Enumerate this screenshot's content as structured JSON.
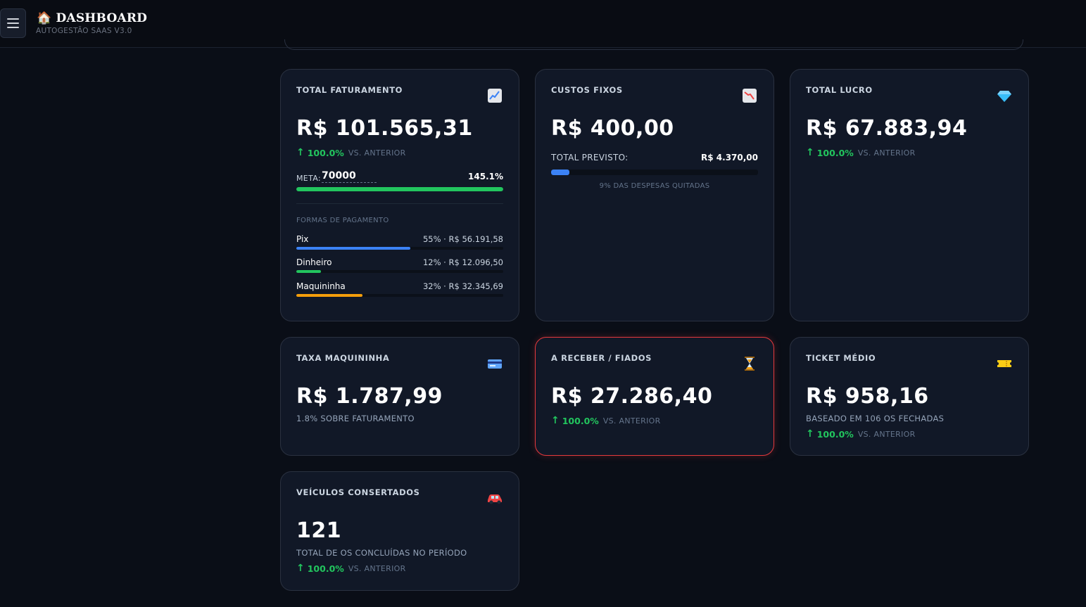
{
  "header": {
    "icon": "house-icon",
    "title": "🏠 DASHBOARD",
    "subtitle": "AUTOGESTÃO SAAS V3.0"
  },
  "colors": {
    "background": "#0a0e17",
    "card": "#111827",
    "positive": "#22c55e",
    "pix": "#3b82f6",
    "dinheiro": "#22c55e",
    "maquininha": "#f59e0b",
    "alert_border": "#e5393d"
  },
  "faturamento": {
    "title": "TOTAL FATURAMENTO",
    "icon": "chart-up-icon",
    "value": "R$ 101.565,31",
    "trend_pct": "100.0%",
    "trend_label": "VS. ANTERIOR",
    "meta_label": "META:",
    "meta_value": "70000",
    "meta_pct": "145.1%",
    "meta_progress": 1.0,
    "payments_label": "FORMAS DE PAGAMENTO",
    "payments": [
      {
        "name": "Pix",
        "detail": "55% · R$ 56.191,58",
        "share": 0.55,
        "color": "#3b82f6"
      },
      {
        "name": "Dinheiro",
        "detail": "12% · R$ 12.096,50",
        "share": 0.12,
        "color": "#22c55e"
      },
      {
        "name": "Maquininha",
        "detail": "32% · R$ 32.345,69",
        "share": 0.32,
        "color": "#f59e0b"
      }
    ]
  },
  "custos": {
    "title": "CUSTOS FIXOS",
    "icon": "chart-down-icon",
    "value": "R$ 400,00",
    "previsto_label": "TOTAL PREVISTO:",
    "previsto_value": "R$ 4.370,00",
    "progress": 0.09,
    "note": "9% DAS DESPESAS QUITADAS"
  },
  "lucro": {
    "title": "TOTAL LUCRO",
    "icon": "gem-icon",
    "value": "R$ 67.883,94",
    "trend_pct": "100.0%",
    "trend_label": "VS. ANTERIOR"
  },
  "taxa": {
    "title": "TAXA MAQUININHA",
    "icon": "credit-card-icon",
    "value": "R$ 1.787,99",
    "subtitle": "1.8% SOBRE FATURAMENTO"
  },
  "receber": {
    "title": "A RECEBER / FIADOS",
    "icon": "hourglass-icon",
    "value": "R$ 27.286,40",
    "trend_pct": "100.0%",
    "trend_label": "VS. ANTERIOR"
  },
  "ticket": {
    "title": "TICKET MÉDIO",
    "icon": "ticket-icon",
    "value": "R$ 958,16",
    "subtitle": "BASEADO EM 106 OS FECHADAS",
    "trend_pct": "100.0%",
    "trend_label": "VS. ANTERIOR"
  },
  "veiculos": {
    "title": "VEÍCULOS CONSERTADOS",
    "icon": "car-icon",
    "value": "121",
    "subtitle": "TOTAL DE OS CONCLUÍDAS NO PERÍODO",
    "trend_pct": "100.0%",
    "trend_label": "VS. ANTERIOR"
  }
}
